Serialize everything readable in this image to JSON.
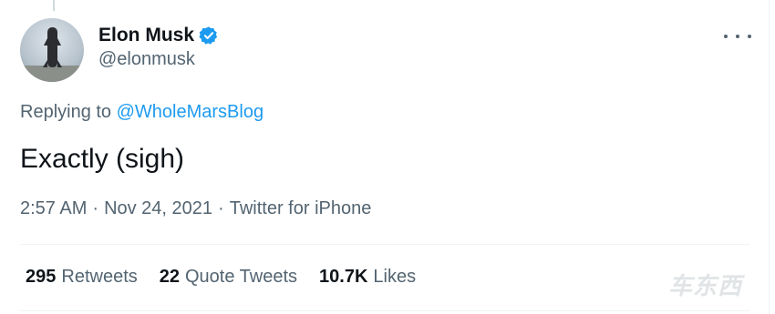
{
  "author": {
    "display_name": "Elon Musk",
    "handle": "@elonmusk",
    "verified_icon": "verified-badge-icon"
  },
  "reply": {
    "prefix": "Replying to",
    "mention": "@WholeMarsBlog"
  },
  "tweet": {
    "text": "Exactly (sigh)"
  },
  "meta": {
    "time": "2:57 AM",
    "date": "Nov 24, 2021",
    "source": "Twitter for iPhone",
    "separator": "·"
  },
  "stats": {
    "retweets_count": "295",
    "retweets_label": "Retweets",
    "quotes_count": "22",
    "quotes_label": "Quote Tweets",
    "likes_count": "10.7K",
    "likes_label": "Likes"
  },
  "watermark": "车东西",
  "colors": {
    "accent": "#1d9bf0",
    "text_primary": "#0f1419",
    "text_secondary": "#536471",
    "divider": "#eff3f4"
  }
}
